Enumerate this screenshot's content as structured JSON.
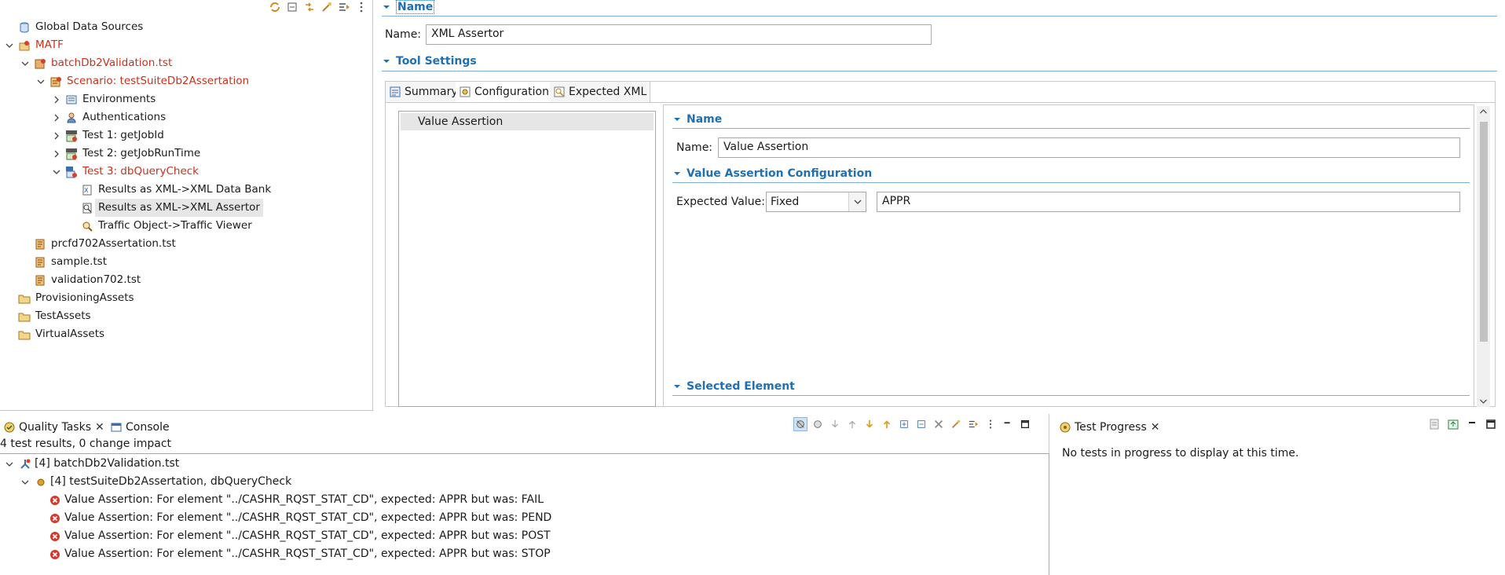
{
  "tree": {
    "items": [
      {
        "label": "Global Data Sources",
        "icon": "global-datasource-icon"
      },
      {
        "label": "MATF",
        "icon": "project-icon"
      },
      {
        "label": "batchDb2Validation.tst",
        "icon": "test-suite-icon"
      },
      {
        "label": "Scenario: testSuiteDb2Assertation",
        "icon": "scenario-icon"
      },
      {
        "label": "Environments",
        "icon": "environments-icon"
      },
      {
        "label": "Authentications",
        "icon": "authentications-icon"
      },
      {
        "label": "Test 1: getJobId",
        "icon": "rest-test-icon"
      },
      {
        "label": "Test 2: getJobRunTime",
        "icon": "rest-test-icon"
      },
      {
        "label": "Test 3: dbQueryCheck",
        "icon": "db-test-icon"
      },
      {
        "label": "Results as XML->XML Data Bank",
        "icon": "xml-databank-icon"
      },
      {
        "label": "Results as XML->XML Assertor",
        "icon": "xml-assertor-icon"
      },
      {
        "label": "Traffic Object->Traffic Viewer",
        "icon": "traffic-viewer-icon"
      },
      {
        "label": "prcfd702Assertation.tst",
        "icon": "tst-file-icon"
      },
      {
        "label": "sample.tst",
        "icon": "tst-file-icon"
      },
      {
        "label": "validation702.tst",
        "icon": "tst-file-icon"
      },
      {
        "label": "ProvisioningAssets",
        "icon": "folder-icon"
      },
      {
        "label": "TestAssets",
        "icon": "folder-icon"
      },
      {
        "label": "VirtualAssets",
        "icon": "folder-icon"
      }
    ]
  },
  "editor": {
    "name_section": "Name",
    "name_label": "Name:",
    "name_value": "XML Assertor",
    "tool_settings_section": "Tool Settings",
    "tabs": [
      "Summary",
      "Configuration",
      "Expected XML"
    ],
    "assertions": [
      "Value Assertion"
    ],
    "detail": {
      "name_section": "Name",
      "name_label": "Name:",
      "name_value": "Value Assertion",
      "config_section": "Value Assertion Configuration",
      "expected_label": "Expected Value:",
      "expected_mode": "Fixed",
      "expected_value": "APPR",
      "selected_section": "Selected Element"
    }
  },
  "quality": {
    "tab_label": "Quality Tasks",
    "console_label": "Console",
    "summary": "4 test results, 0 change impact",
    "suite": "[4] batchDb2Validation.tst",
    "scenario": "[4] testSuiteDb2Assertation, dbQueryCheck",
    "errors": [
      "Value Assertion: For element \"../CASHR_RQST_STAT_CD\", expected: APPR but was: FAIL",
      "Value Assertion: For element \"../CASHR_RQST_STAT_CD\", expected: APPR but was: PEND",
      "Value Assertion: For element \"../CASHR_RQST_STAT_CD\", expected: APPR but was: POST",
      "Value Assertion: For element \"../CASHR_RQST_STAT_CD\", expected: APPR but was: STOP"
    ]
  },
  "progress": {
    "tab_label": "Test Progress",
    "message": "No tests in progress to display at this time."
  },
  "colors": {
    "accent": "#1f6fb4",
    "error_red": "#c8311b"
  }
}
